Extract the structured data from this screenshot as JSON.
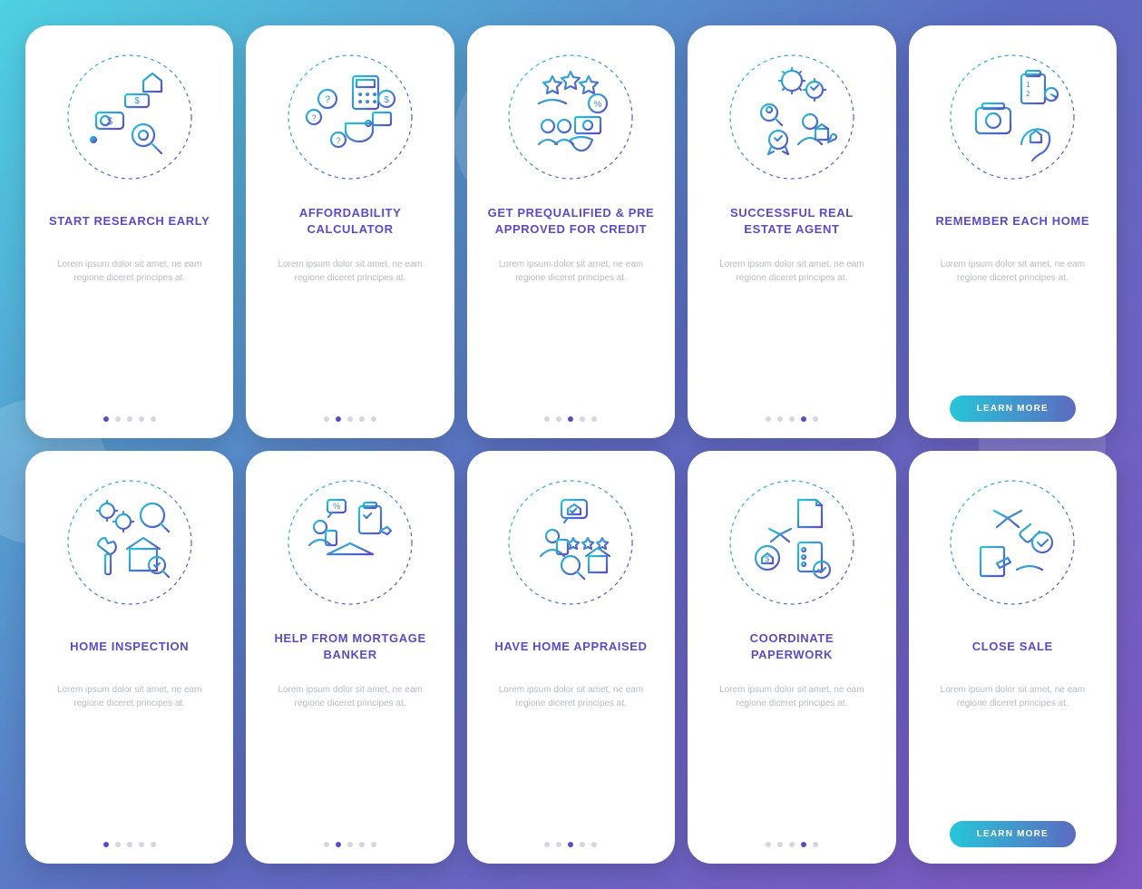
{
  "lorem": "Lorem ipsum dolor sit amet, ne eam regione diceret principes at.",
  "button_label": "LEARN MORE",
  "accent": "#5B4BC4",
  "cards": [
    {
      "title": "START RESEARCH EARLY",
      "active_dot": 0,
      "has_button": false
    },
    {
      "title": "AFFORDABILITY CALCULATOR",
      "active_dot": 1,
      "has_button": false
    },
    {
      "title": "GET PREQUALIFIED & PRE APPROVED FOR CREDIT",
      "active_dot": 2,
      "has_button": false
    },
    {
      "title": "SUCCESSFUL REAL ESTATE AGENT",
      "active_dot": 3,
      "has_button": false
    },
    {
      "title": "REMEMBER EACH HOME",
      "active_dot": -1,
      "has_button": true
    },
    {
      "title": "HOME INSPECTION",
      "active_dot": 0,
      "has_button": false
    },
    {
      "title": "HELP FROM MORTGAGE BANKER",
      "active_dot": 1,
      "has_button": false
    },
    {
      "title": "HAVE HOME APPRAISED",
      "active_dot": 2,
      "has_button": false
    },
    {
      "title": "COORDINATE PAPERWORK",
      "active_dot": 3,
      "has_button": false
    },
    {
      "title": "CLOSE SALE",
      "active_dot": -1,
      "has_button": true
    }
  ]
}
